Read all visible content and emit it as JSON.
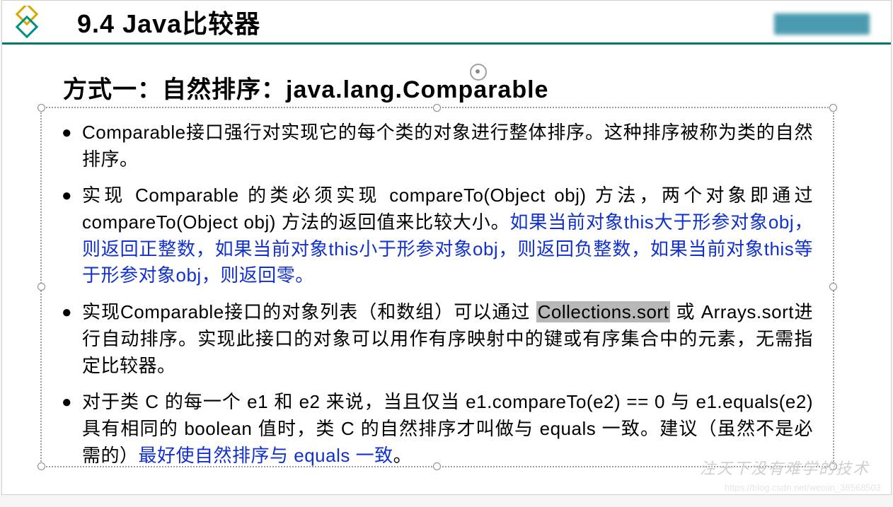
{
  "header": {
    "section_number": "9.4",
    "section_title": "Java比较器"
  },
  "subtitle": "方式一：自然排序：java.lang.Comparable",
  "bullets": [
    {
      "segments": [
        {
          "t": "Comparable接口强行对实现它的每个类的对象进行整体排序。这种排序被称为类的自然排序。",
          "c": ""
        }
      ]
    },
    {
      "segments": [
        {
          "t": "实现 Comparable 的类必须实现 compareTo(Object obj) 方法，两个对象即通过 compareTo(Object obj) 方法的返回值来比较大小。",
          "c": ""
        },
        {
          "t": "如果当前对象this大于形参对象obj，则返回正整数，如果当前对象this小于形参对象obj，则返回负整数，如果当前对象this等于形参对象obj，则返回零。",
          "c": "blue"
        }
      ]
    },
    {
      "segments": [
        {
          "t": "实现Comparable接口的对象列表（和数组）可以通过 ",
          "c": ""
        },
        {
          "t": "Collections.sort",
          "c": "hl"
        },
        {
          "t": " 或 Arrays.sort进行自动排序。实现此接口的对象可以用作有序映射中的键或有序集合中的元素，无需指定比较器。",
          "c": ""
        }
      ]
    },
    {
      "segments": [
        {
          "t": "对于类 C 的每一个 e1 和 e2 来说，当且仅当 e1.compareTo(e2) == 0 与 e1.equals(e2) 具有相同的 boolean 值时，类 C 的自然排序才叫做与 equals 一致。建议（虽然不是必需的）",
          "c": ""
        },
        {
          "t": "最好使自然排序与 equals 一致",
          "c": "blue"
        },
        {
          "t": "。",
          "c": ""
        }
      ]
    }
  ],
  "watermark": "注天下没有难学的技术",
  "footer_url": "https://blog.csdn.net/weixin_38568503"
}
